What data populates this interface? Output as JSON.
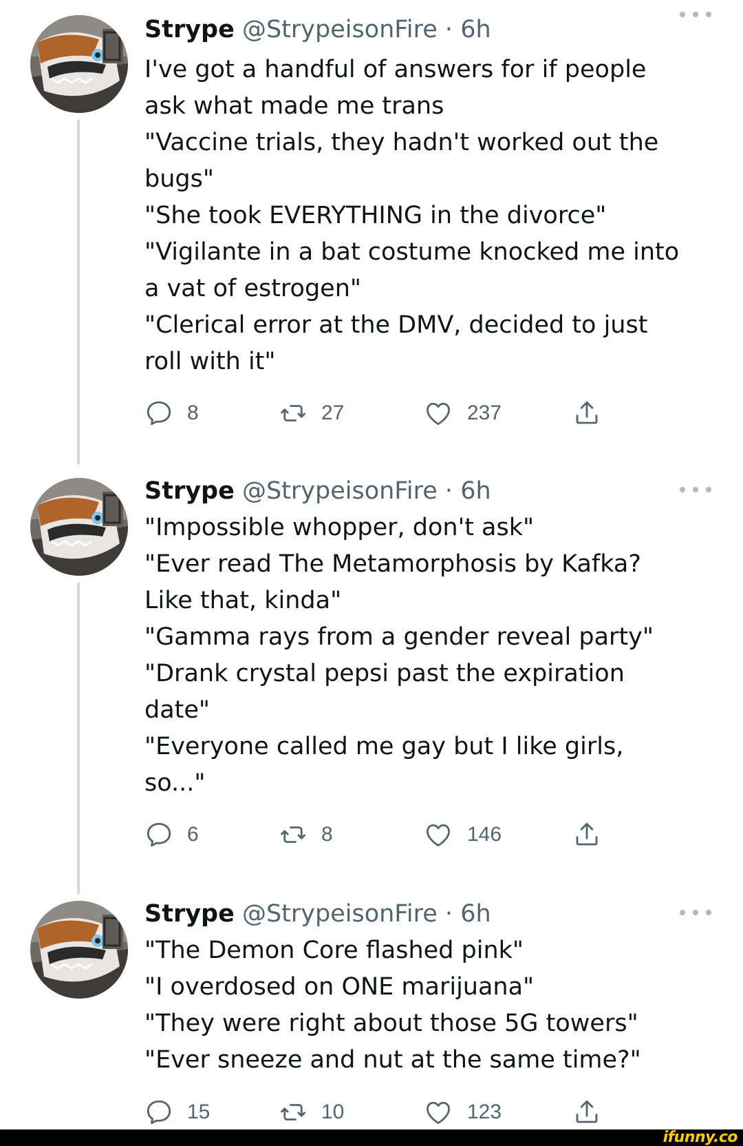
{
  "tweets": [
    {
      "name": "Strype",
      "handle": "@StrypeisonFire",
      "separator": "·",
      "time": "6h",
      "lines": [
        "I've got a handful of answers for if people",
        "ask what made me trans",
        "\"Vaccine trials, they hadn't worked out the",
        "bugs\"",
        "\"She took EVERYTHING in the divorce\"",
        "\"Vigilante in a bat costume knocked me into",
        "a vat of estrogen\"",
        "\"Clerical error at the DMV, decided to just",
        "roll with it\""
      ],
      "replies": "8",
      "retweets": "27",
      "likes": "237"
    },
    {
      "name": "Strype",
      "handle": "@StrypeisonFire",
      "separator": "·",
      "time": "6h",
      "lines": [
        "\"Impossible whopper, don't ask\"",
        "\"Ever read The Metamorphosis by Kafka?",
        "Like that, kinda\"",
        "\"Gamma rays from a gender reveal party\"",
        "\"Drank crystal pepsi past the expiration",
        "date\"",
        "\"Everyone called me gay but I like girls,",
        "so...\""
      ],
      "replies": "6",
      "retweets": "8",
      "likes": "146"
    },
    {
      "name": "Strype",
      "handle": "@StrypeisonFire",
      "separator": "·",
      "time": "6h",
      "lines": [
        "\"The Demon Core flashed pink\"",
        "\"I overdosed on ONE marijuana\"",
        "\"They were right about those 5G towers\"",
        "\"Ever sneeze and nut at the same time?\""
      ],
      "replies": "15",
      "retweets": "10",
      "likes": "123"
    }
  ],
  "icons": {
    "reply": "reply-icon",
    "retweet": "retweet-icon",
    "like": "heart-icon",
    "share": "share-icon",
    "more": "more-icon"
  },
  "watermark": "ifunny.co",
  "colors": {
    "text": "#0f1419",
    "secondary": "#536471",
    "thread_line": "#cfd9de",
    "watermark": "#ffcc00"
  }
}
